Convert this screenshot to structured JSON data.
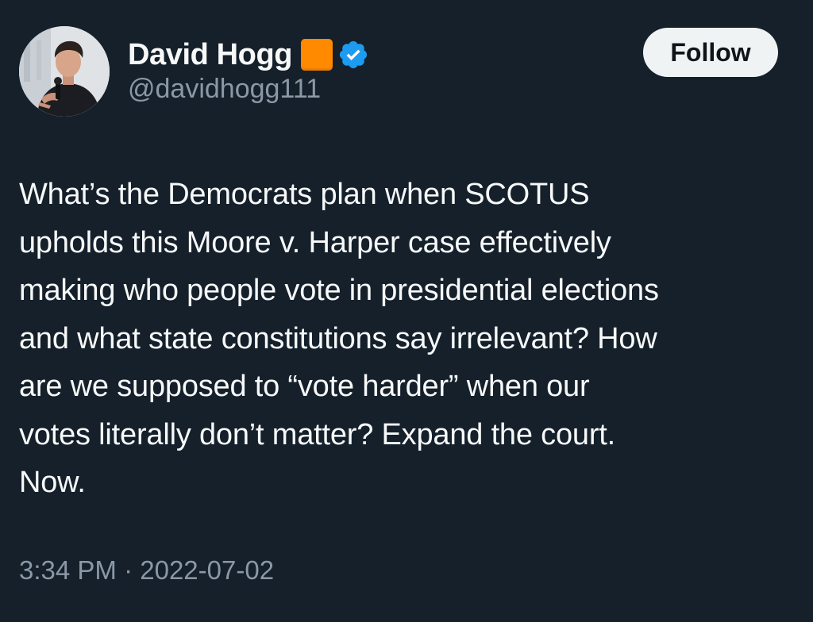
{
  "user": {
    "display_name": "David Hogg",
    "handle": "@davidhogg111",
    "emoji": "orange-square",
    "verified": true,
    "avatar": "profile-photo"
  },
  "follow_button": {
    "label": "Follow"
  },
  "tweet": {
    "text": "What’s the Democrats plan when SCOTUS\nupholds this Moore v. Harper case effectively\nmaking who people vote in presidential elections\nand what state constitutions say irrelevant? How\nare we supposed to “vote harder” when our\nvotes literally don’t matter? Expand the court.\nNow.",
    "time": "3:34 PM",
    "separator": "·",
    "date": "2022-07-02"
  },
  "colors": {
    "background": "#15202b",
    "primary_text": "#f7f9f9",
    "secondary_text": "#8b98a5",
    "verified_badge": "#1d9bf0",
    "emoji_orange": "#ff8a00",
    "follow_bg": "#eff3f4"
  }
}
